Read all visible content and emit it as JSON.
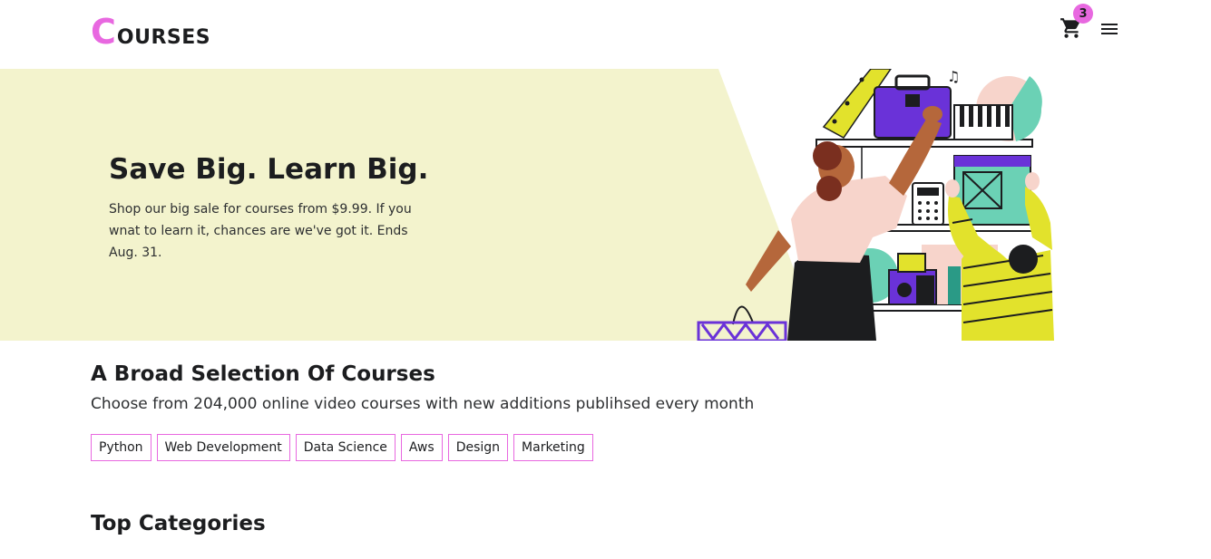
{
  "header": {
    "logo_initial": "C",
    "logo_rest": "OURSES",
    "cart_count": "3",
    "cart_icon": "cart-icon",
    "menu_icon": "hamburger-menu-icon"
  },
  "banner": {
    "title": "Save Big. Learn Big.",
    "description": "Shop our big sale for courses from $9.99. If you wnat to learn it, chances are we've got it. Ends Aug. 31.",
    "illustration": "shopping-illustration"
  },
  "selection": {
    "title": "A Broad Selection Of Courses",
    "subtitle": "Choose from 204,000 online video courses with new additions publihsed every month",
    "tags": [
      "Python",
      "Web Development",
      "Data Science",
      "Aws",
      "Design",
      "Marketing"
    ]
  },
  "categories": {
    "title": "Top Categories"
  },
  "colors": {
    "accent": "#e868e0",
    "banner_bg": "#f3f3cd",
    "text": "#1c1d1f"
  }
}
